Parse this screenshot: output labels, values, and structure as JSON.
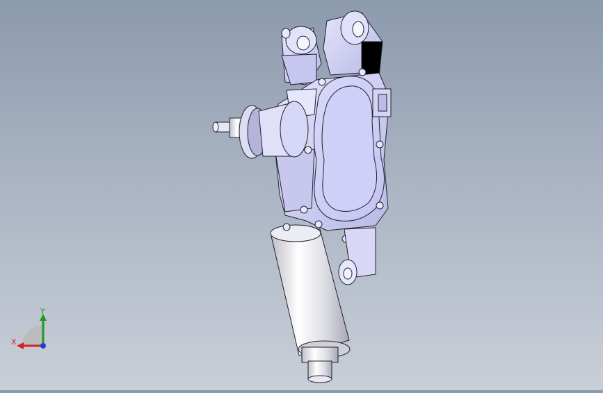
{
  "viewport": {
    "model": "wiper-motor-assembly",
    "background_top": "#8c9aae",
    "background_bottom": "#c9cfd8",
    "part_color": "#d2d2f4",
    "edge_color": "#202030"
  },
  "triad": {
    "x_label": "X",
    "y_label": "Y",
    "x_color": "#d42020",
    "y_color": "#1f9a1f",
    "z_color": "#1f3fd4"
  }
}
